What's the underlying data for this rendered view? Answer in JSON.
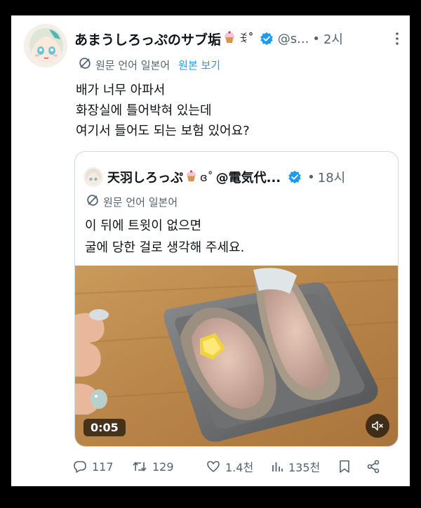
{
  "tweet": {
    "display_name": "あまうしろっぷのサブ垢",
    "name_kaomoji": "ꉂ˚",
    "name_kaomoji_prefix": "ɞ",
    "handle": "@s...",
    "separator": "•",
    "time": "2시",
    "translate_label": "원문 언어 일본어",
    "show_original": "원본 보기",
    "text_lines": [
      "배가 너무 아파서",
      "화장실에 틀어박혀 있는데",
      "여기서 들어도 되는 보험 있어요?"
    ]
  },
  "quote": {
    "display_name": "天羽しろっぷ",
    "name_kaomoji": "ɞ˚",
    "handle": "@電気代...",
    "separator": "•",
    "time": "18시",
    "translate_label": "원문 언어 일본어",
    "text_lines": [
      "이 뒤에 트윗이 없으면",
      "굴에 당한 걸로 생각해 주세요."
    ],
    "video_duration": "0:05"
  },
  "actions": {
    "replies": "117",
    "retweets": "129",
    "likes": "1.4천",
    "views": "135천"
  },
  "icons": {
    "verified": "verified-badge-icon",
    "more": "more-dots-icon",
    "translate": "translate-icon",
    "reply": "reply-icon",
    "retweet": "retweet-icon",
    "like": "heart-icon",
    "views": "views-chart-icon",
    "bookmark": "bookmark-icon",
    "share": "share-icon",
    "mute": "volume-mute-icon"
  },
  "colors": {
    "accent": "#1d9bf0",
    "secondary_text": "#536471",
    "primary_text": "#0f1419"
  }
}
